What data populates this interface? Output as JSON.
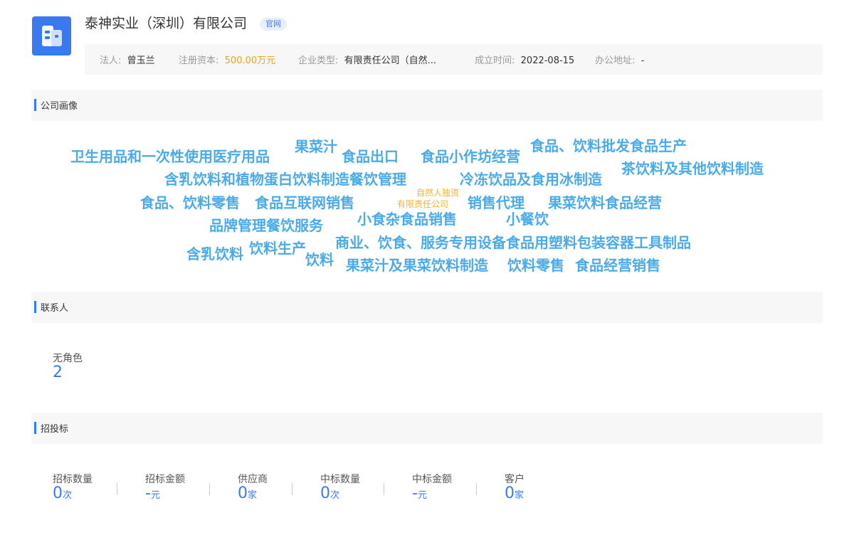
{
  "company": {
    "name": "泰神实业（深圳）有限公司",
    "badge": "官网",
    "logo_icon": "building-icon",
    "logo_color": "#3a7af0"
  },
  "info": {
    "legal_person_label": "法人:",
    "legal_person": "曾玉兰",
    "capital_label": "注册资本:",
    "capital": "500.00万元",
    "type_label": "企业类型:",
    "type": "有限责任公司（自然...",
    "founded_label": "成立时间:",
    "founded": "2022-08-15",
    "address_label": "办公地址:",
    "address": "-"
  },
  "portrait": {
    "title": "公司画像",
    "words": [
      "卫生用品和一次性使用医疗用品",
      "果菜汁",
      "食品出口",
      "食品小作坊经营",
      "食品、饮料批发食品生产",
      "含乳饮料和植物蛋白饮料制造餐饮管理",
      "冷冻饮品及食用冰制造",
      "茶饮料及其他饮料制造",
      "食品、饮料零售",
      "食品互联网销售",
      "销售代理",
      "果菜饮料食品经营",
      "品牌管理餐饮服务",
      "小食杂食品销售",
      "小餐饮",
      "含乳饮料",
      "饮料生产",
      "商业、饮食、服务专用设备食品用塑料包装容器工具制品",
      "饮料",
      "果菜汁及果菜饮料制造",
      "饮料零售",
      "食品经营销售"
    ],
    "center_line1": "自然人独资",
    "center_line2": "有限责任公司",
    "word_color": "#4aabe8",
    "center_color": "#f5b32a"
  },
  "contacts": {
    "title": "联系人",
    "role_label": "无角色",
    "role_count": "2"
  },
  "bidding": {
    "title": "招投标",
    "stats": [
      {
        "label": "招标数量",
        "value": "0",
        "unit": "次"
      },
      {
        "label": "招标金额",
        "value": "-",
        "unit": "元"
      },
      {
        "label": "供应商",
        "value": "0",
        "unit": "家"
      },
      {
        "label": "中标数量",
        "value": "0",
        "unit": "次"
      },
      {
        "label": "中标金额",
        "value": "-",
        "unit": "元"
      },
      {
        "label": "客户",
        "value": "0",
        "unit": "家"
      }
    ]
  }
}
